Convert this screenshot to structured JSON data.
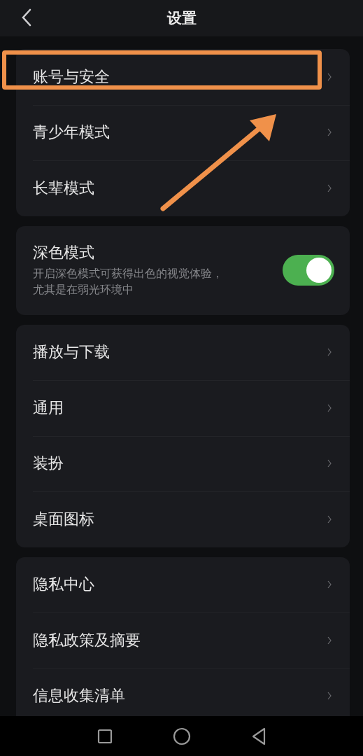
{
  "header": {
    "title": "设置"
  },
  "groups": [
    {
      "items": [
        {
          "kind": "link",
          "label": "账号与安全",
          "highlighted": true
        },
        {
          "kind": "link",
          "label": "青少年模式",
          "highlighted": false
        },
        {
          "kind": "link",
          "label": "长辈模式",
          "highlighted": false
        }
      ]
    },
    {
      "items": [
        {
          "kind": "toggle",
          "label": "深色模式",
          "description_lines": [
            "开启深色模式可获得出色的视觉体验，",
            "尤其是在弱光环境中"
          ],
          "on": true
        }
      ]
    },
    {
      "items": [
        {
          "kind": "link",
          "label": "播放与下载",
          "highlighted": false
        },
        {
          "kind": "link",
          "label": "通用",
          "highlighted": false
        },
        {
          "kind": "link",
          "label": "装扮",
          "highlighted": false
        },
        {
          "kind": "link",
          "label": "桌面图标",
          "highlighted": false
        }
      ]
    },
    {
      "items": [
        {
          "kind": "link",
          "label": "隐私中心",
          "highlighted": false
        },
        {
          "kind": "link",
          "label": "隐私政策及摘要",
          "highlighted": false
        },
        {
          "kind": "link",
          "label": "信息收集清单",
          "highlighted": false
        }
      ]
    }
  ]
}
